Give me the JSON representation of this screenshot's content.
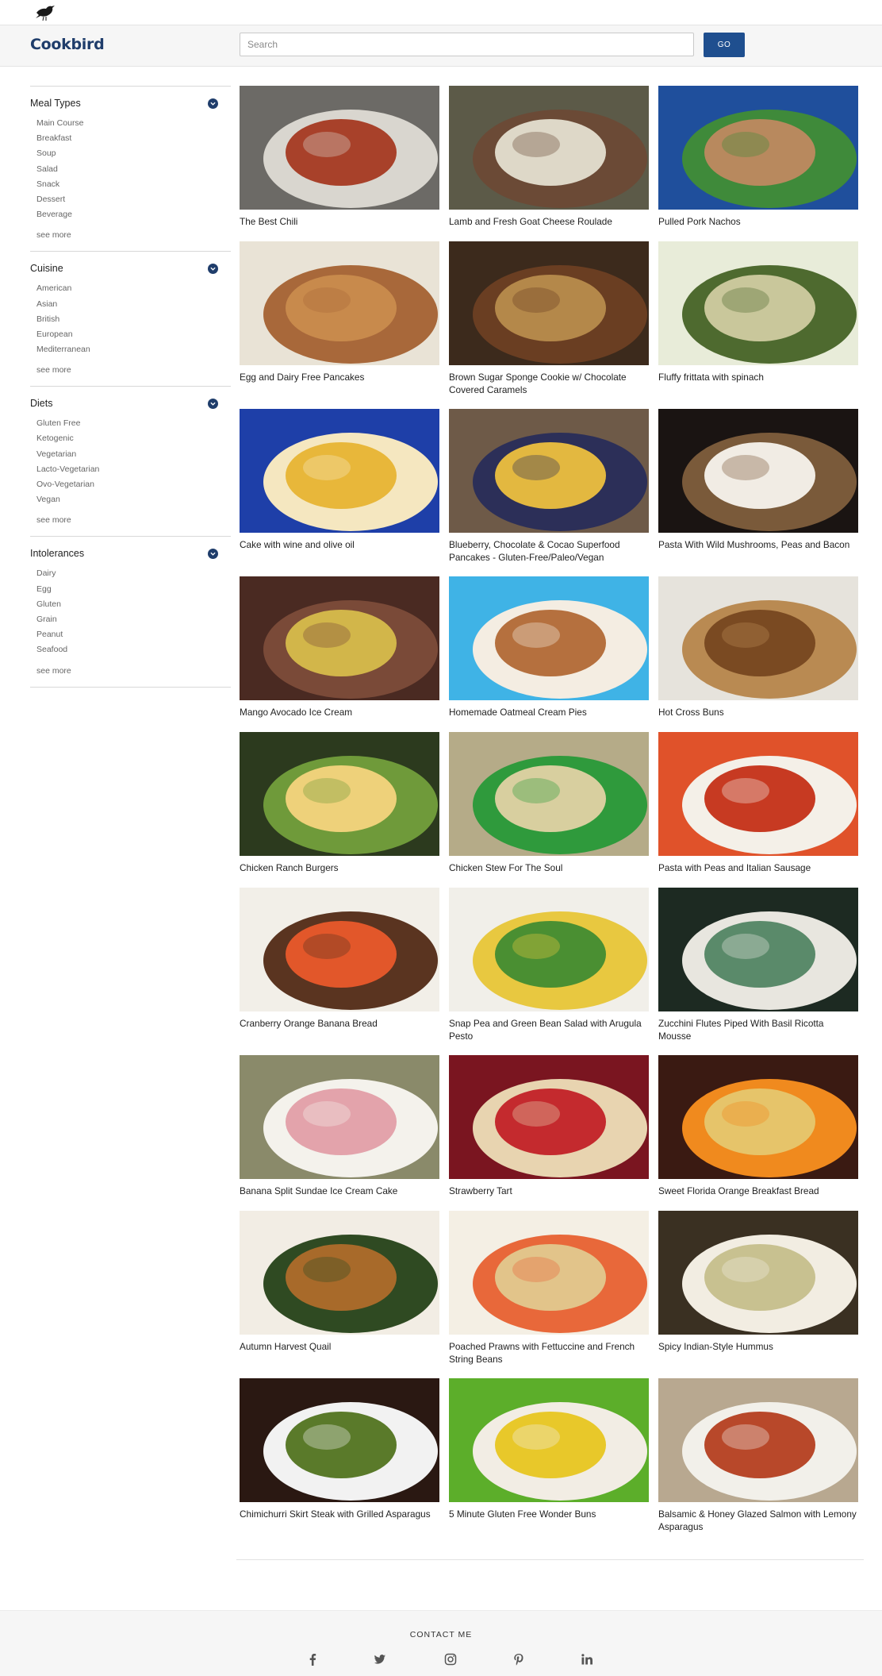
{
  "header": {
    "brand": "Cookbird",
    "search_placeholder": "Search",
    "go_label": "GO"
  },
  "sidebar": {
    "facets": [
      {
        "title": "Meal Types",
        "items": [
          "Main Course",
          "Breakfast",
          "Soup",
          "Salad",
          "Snack",
          "Dessert",
          "Beverage"
        ],
        "see_more": "see more"
      },
      {
        "title": "Cuisine",
        "items": [
          "American",
          "Asian",
          "British",
          "European",
          "Mediterranean"
        ],
        "see_more": "see more"
      },
      {
        "title": "Diets",
        "items": [
          "Gluten Free",
          "Ketogenic",
          "Vegetarian",
          "Lacto-Vegetarian",
          "Ovo-Vegetarian",
          "Vegan"
        ],
        "see_more": "see more"
      },
      {
        "title": "Intolerances",
        "items": [
          "Dairy",
          "Egg",
          "Gluten",
          "Grain",
          "Peanut",
          "Seafood"
        ],
        "see_more": "see more"
      }
    ]
  },
  "recipes": [
    {
      "title": "The Best Chili",
      "colors": [
        "#6c6a66",
        "#a8412a",
        "#d9d6cf"
      ]
    },
    {
      "title": "Lamb and Fresh Goat Cheese Roulade",
      "colors": [
        "#5c5a48",
        "#ded8c8",
        "#6b4a36"
      ]
    },
    {
      "title": "Pulled Pork Nachos",
      "colors": [
        "#1f4f9c",
        "#b8895e",
        "#3f8a3a"
      ]
    },
    {
      "title": "Egg and Dairy Free Pancakes",
      "colors": [
        "#e9e3d6",
        "#c88a4c",
        "#a8683a"
      ]
    },
    {
      "title": "Brown Sugar Sponge Cookie w/ Chocolate Covered Caramels",
      "colors": [
        "#3c2a1c",
        "#b4884a",
        "#6a3e22"
      ]
    },
    {
      "title": "Fluffy frittata with spinach",
      "colors": [
        "#e8ecd9",
        "#c9c79b",
        "#4e6a2f"
      ]
    },
    {
      "title": "Cake with wine and olive oil",
      "colors": [
        "#1e3fa8",
        "#e8b73a",
        "#f5e7c0"
      ]
    },
    {
      "title": "Blueberry, Chocolate & Cocao Superfood Pancakes - Gluten-Free/Paleo/Vegan",
      "colors": [
        "#6e5a48",
        "#e3b840",
        "#2c2f58"
      ]
    },
    {
      "title": "Pasta With Wild Mushrooms, Peas and Bacon",
      "colors": [
        "#1a1412",
        "#f1ece4",
        "#7a5a3a"
      ]
    },
    {
      "title": "Mango Avocado Ice Cream",
      "colors": [
        "#4a2a22",
        "#d2b64a",
        "#7a4a38"
      ]
    },
    {
      "title": "Homemade Oatmeal Cream Pies",
      "colors": [
        "#3fb3e6",
        "#b5703e",
        "#f4ede2"
      ]
    },
    {
      "title": "Hot Cross Buns",
      "colors": [
        "#e6e3dc",
        "#7a4a22",
        "#b98a52"
      ]
    },
    {
      "title": "Chicken Ranch Burgers",
      "colors": [
        "#2c3a1e",
        "#eed17a",
        "#6f9a3a"
      ]
    },
    {
      "title": "Chicken Stew For The Soul",
      "colors": [
        "#b5ab88",
        "#d8cf9f",
        "#2f9a3c"
      ]
    },
    {
      "title": "Pasta with Peas and Italian Sausage",
      "colors": [
        "#e0522a",
        "#c73a22",
        "#f4f0e8"
      ]
    },
    {
      "title": "Cranberry Orange Banana Bread",
      "colors": [
        "#f2efe8",
        "#e2572a",
        "#5a3420"
      ]
    },
    {
      "title": "Snap Pea and Green Bean Salad with Arugula Pesto",
      "colors": [
        "#f1efe9",
        "#4a8f32",
        "#e8c840"
      ]
    },
    {
      "title": "Zucchini Flutes Piped With Basil Ricotta Mousse",
      "colors": [
        "#1d2a22",
        "#5a8a6a",
        "#e8e6df"
      ]
    },
    {
      "title": "Banana Split Sundae Ice Cream Cake",
      "colors": [
        "#8a8a6a",
        "#e3a3ab",
        "#f4f2ec"
      ]
    },
    {
      "title": "Strawberry Tart",
      "colors": [
        "#7a1520",
        "#c42a2e",
        "#e8d4b0"
      ]
    },
    {
      "title": "Sweet Florida Orange Breakfast Bread",
      "colors": [
        "#3a1a12",
        "#e6c46a",
        "#f08a1e"
      ]
    },
    {
      "title": "Autumn Harvest Quail",
      "colors": [
        "#f2ede4",
        "#a86a2a",
        "#2f4a22"
      ]
    },
    {
      "title": "Poached Prawns with Fettuccine and French String Beans",
      "colors": [
        "#f4efe4",
        "#e2c48a",
        "#e8683a"
      ]
    },
    {
      "title": "Spicy Indian-Style Hummus",
      "colors": [
        "#3a3022",
        "#c8c190",
        "#f2ede2"
      ]
    },
    {
      "title": "Chimichurri Skirt Steak with Grilled Asparagus",
      "colors": [
        "#2a1812",
        "#5a7a2a",
        "#f2f2f2"
      ]
    },
    {
      "title": "5 Minute Gluten Free Wonder Buns",
      "colors": [
        "#5cae2a",
        "#e8c82a",
        "#f2ede4"
      ]
    },
    {
      "title": "Balsamic & Honey Glazed Salmon with Lemony Asparagus",
      "colors": [
        "#b8a890",
        "#b8482a",
        "#f2f0ea"
      ]
    }
  ],
  "footer": {
    "contact_label": "CONTACT ME",
    "social_icons": [
      "facebook-icon",
      "twitter-icon",
      "instagram-icon",
      "pinterest-icon",
      "linkedin-icon"
    ]
  },
  "colors": {
    "brand": "#1f3d6b",
    "go_button": "#1f4f8f",
    "header_bg": "#f6f6f6"
  }
}
